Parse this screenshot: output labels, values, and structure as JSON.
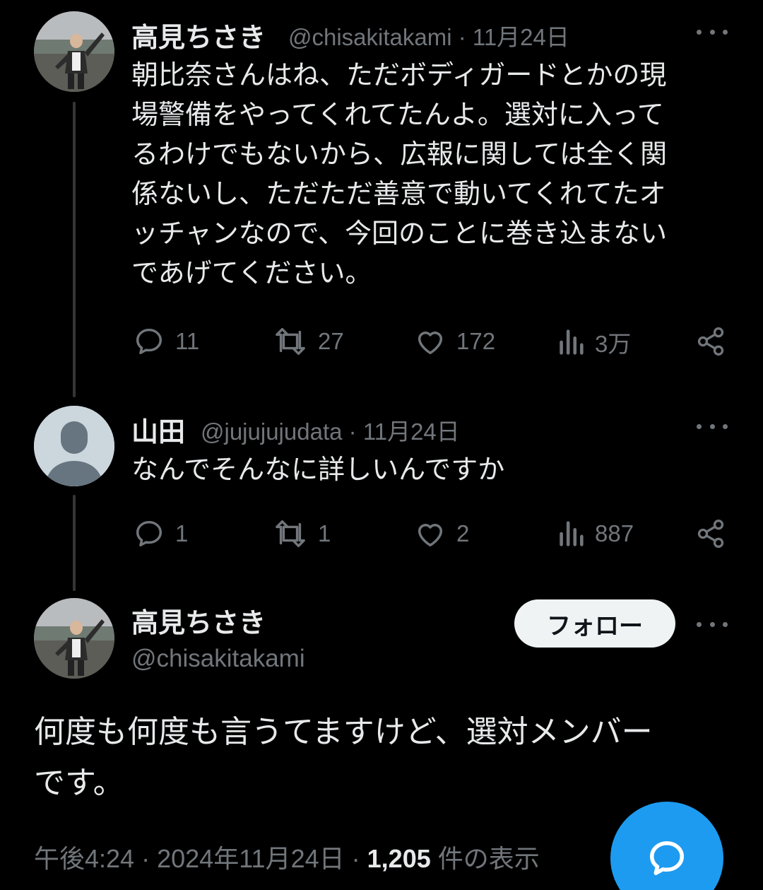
{
  "tweets": [
    {
      "display_name": "高見ちさき",
      "handle": "@chisakitakami",
      "separator": "·",
      "date": "11月24日",
      "lines": [
        "朝比奈さんはね、ただボディガードとかの現",
        "場警備をやってくれてたんよ。選対に入って",
        "るわけでもないから、広報に関しては全く関",
        "係ないし、ただただ善意で動いてくれてたオ",
        "ッチャンなので、今回のことに巻き込まない",
        "であげてください。"
      ],
      "replies": "11",
      "reposts": "27",
      "likes": "172",
      "views": "3万"
    },
    {
      "display_name": "山田",
      "handle": "@jujujujudata",
      "separator": "·",
      "date": "11月24日",
      "lines": [
        "なんでそんなに詳しいんですか"
      ],
      "replies": "1",
      "reposts": "1",
      "likes": "2",
      "views": "887"
    }
  ],
  "focused": {
    "display_name": "高見ちさき",
    "handle": "@chisakitakami",
    "follow_label": "フォロー",
    "lines": [
      "何度も何度も言うてますけど、選対メンバー",
      "です。"
    ],
    "time": "午後4:24",
    "date": "2024年11月24日",
    "separator": "·",
    "view_count": "1,205",
    "view_suffix": "件の表示"
  },
  "icons": {
    "reply": "reply-icon",
    "repost": "repost-icon",
    "like": "heart-icon",
    "views": "analytics-icon",
    "share": "share-icon",
    "more": "more-icon",
    "compose": "compose-reply-icon"
  },
  "colors": {
    "background": "#000000",
    "text": "#e7e9ea",
    "secondary": "#71767b",
    "accent": "#1d9bf0"
  }
}
